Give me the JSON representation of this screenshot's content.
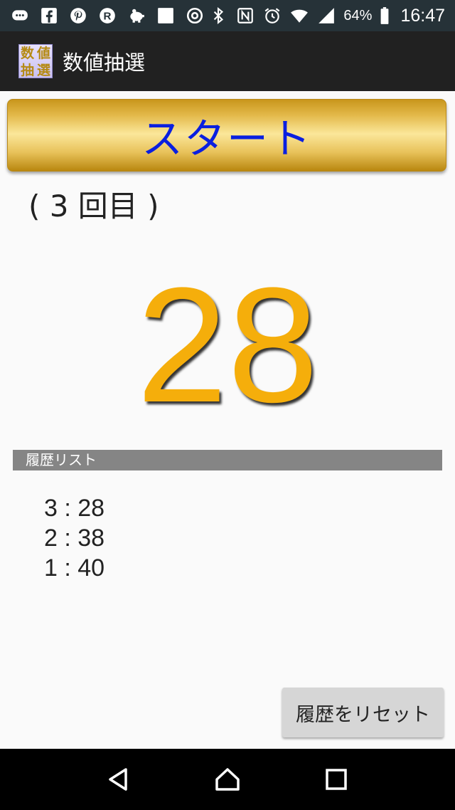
{
  "status_bar": {
    "battery": "64%",
    "time": "16:47",
    "icons_left": [
      "chat-icon",
      "facebook-icon",
      "pinterest-icon",
      "rakuten-icon",
      "piggy-bank-icon",
      "blank-app-icon",
      "at-icon"
    ],
    "icons_right": [
      "bluetooth-icon",
      "nfc-icon",
      "alarm-icon",
      "wifi-icon",
      "signal-icon",
      "battery-icon"
    ]
  },
  "app_bar": {
    "icon_chars": [
      "数",
      "値",
      "抽",
      "選"
    ],
    "title": "数値抽選"
  },
  "main": {
    "start_label": "スタート",
    "round_label": "( 3 回目 )",
    "result": "28"
  },
  "history": {
    "header": "履歴リスト",
    "items": [
      "3 : 28",
      "2 : 38",
      "1 : 40"
    ],
    "reset_label": "履歴をリセット"
  },
  "colors": {
    "result": "#f5ae0b",
    "start_text": "#0a1fe0",
    "header_bg": "#858585"
  }
}
